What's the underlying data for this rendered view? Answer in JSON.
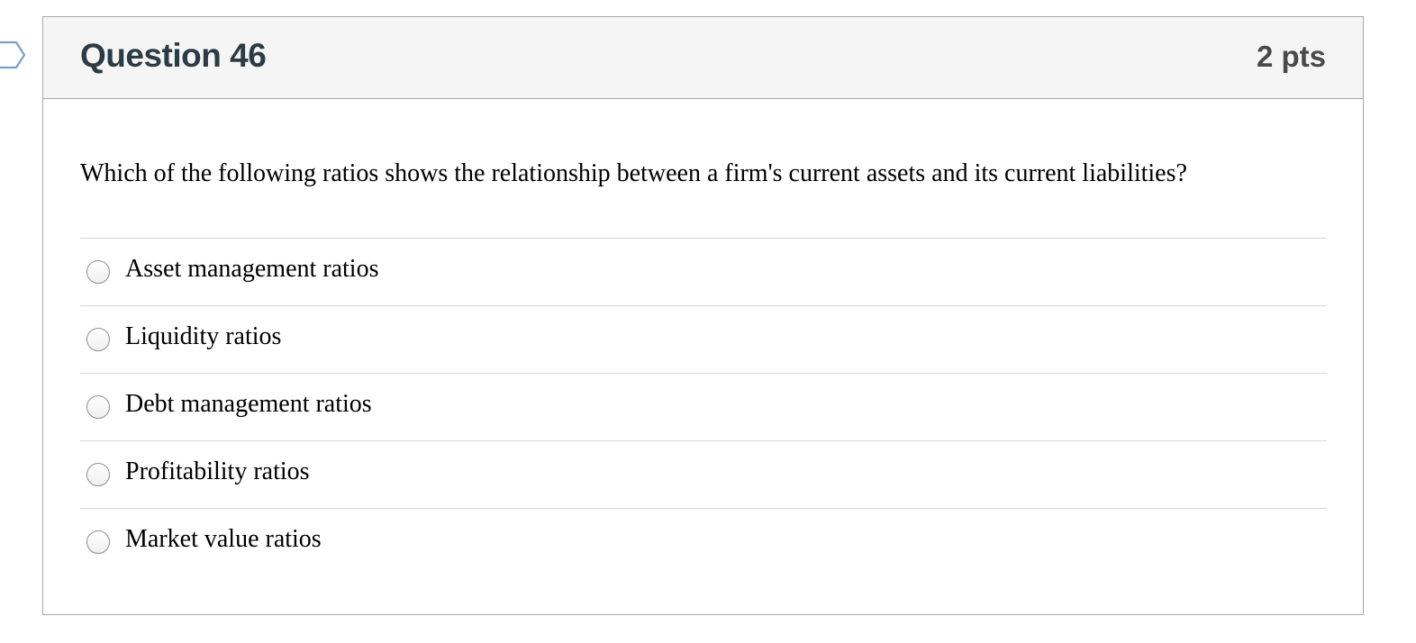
{
  "question": {
    "title": "Question 46",
    "points": "2 pts",
    "text": "Which of the following ratios shows the relationship between a firm's current assets and its current liabilities?",
    "answers": [
      {
        "label": "Asset management ratios",
        "selected": false
      },
      {
        "label": "Liquidity ratios",
        "selected": false
      },
      {
        "label": "Debt management ratios",
        "selected": false
      },
      {
        "label": "Profitability ratios",
        "selected": false
      },
      {
        "label": "Market value ratios",
        "selected": false
      }
    ]
  },
  "icons": {
    "flag": "bookmark-flag-icon"
  },
  "colors": {
    "header_bg": "#f5f5f5",
    "border": "#a8a8a8",
    "divider": "#d8d8d8",
    "title": "#2d3b45"
  }
}
